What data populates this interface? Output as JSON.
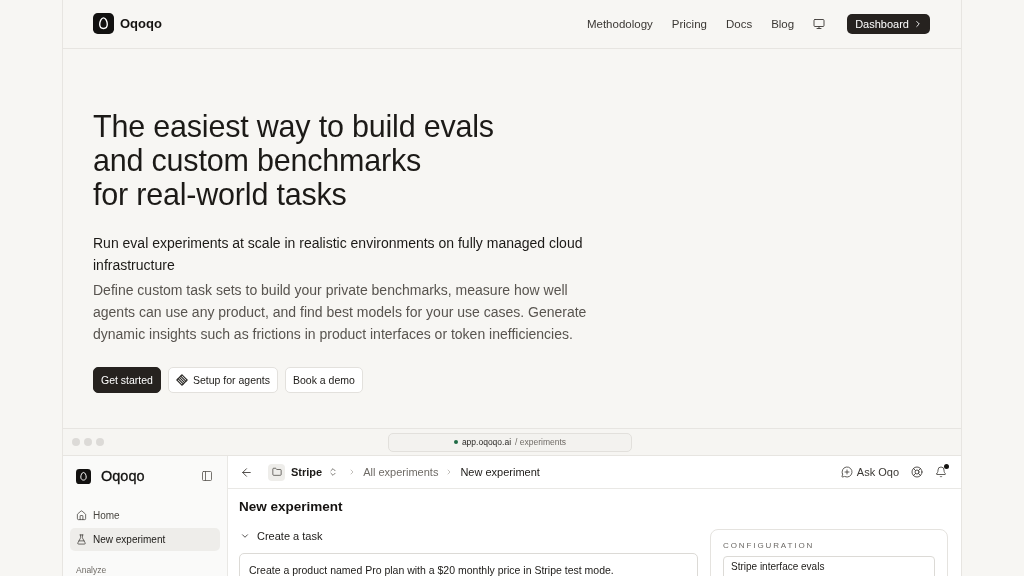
{
  "header": {
    "brand": "Oqoqo",
    "nav": [
      "Methodology",
      "Pricing",
      "Docs",
      "Blog"
    ],
    "cta": "Dashboard"
  },
  "hero": {
    "headline": [
      "The easiest way to build evals",
      "and custom benchmarks",
      "for real-world tasks"
    ],
    "subtitle": "Run eval experiments at scale in realistic environments on fully managed cloud infrastructure",
    "description": "Define custom task sets to build your private benchmarks, measure how well agents can use any product, and find best models for your use cases. Generate dynamic insights such as frictions in product interfaces or token inefficiencies.",
    "buttons": [
      {
        "label": "Get started",
        "kind": "primary"
      },
      {
        "label": "Setup for agents",
        "kind": "with_icon"
      },
      {
        "label": "Book a demo",
        "kind": "secondary"
      }
    ]
  },
  "browser": {
    "url_host": "app.oqoqo.ai",
    "url_path": "/ experiments"
  },
  "app": {
    "sidebar": {
      "brand": "Oqoqo",
      "items": [
        {
          "label": "Home",
          "selected": false
        },
        {
          "label": "New experiment",
          "selected": true
        }
      ],
      "section_label": "Analyze"
    },
    "toolbar": {
      "project": "Stripe",
      "breadcrumbs": [
        {
          "label": "All experiments",
          "current": false
        },
        {
          "label": "New experiment",
          "current": true
        }
      ],
      "ask_label": "Ask Oqo",
      "notifications_unread": true
    },
    "page_title": "New experiment",
    "task_section": {
      "label": "Create a task",
      "expanded": true,
      "value": "Create a product named Pro plan with a $20 monthly price in Stripe test mode."
    },
    "configuration": {
      "heading": "CONFIGURATION",
      "name_value": "Stripe interface evals"
    }
  }
}
